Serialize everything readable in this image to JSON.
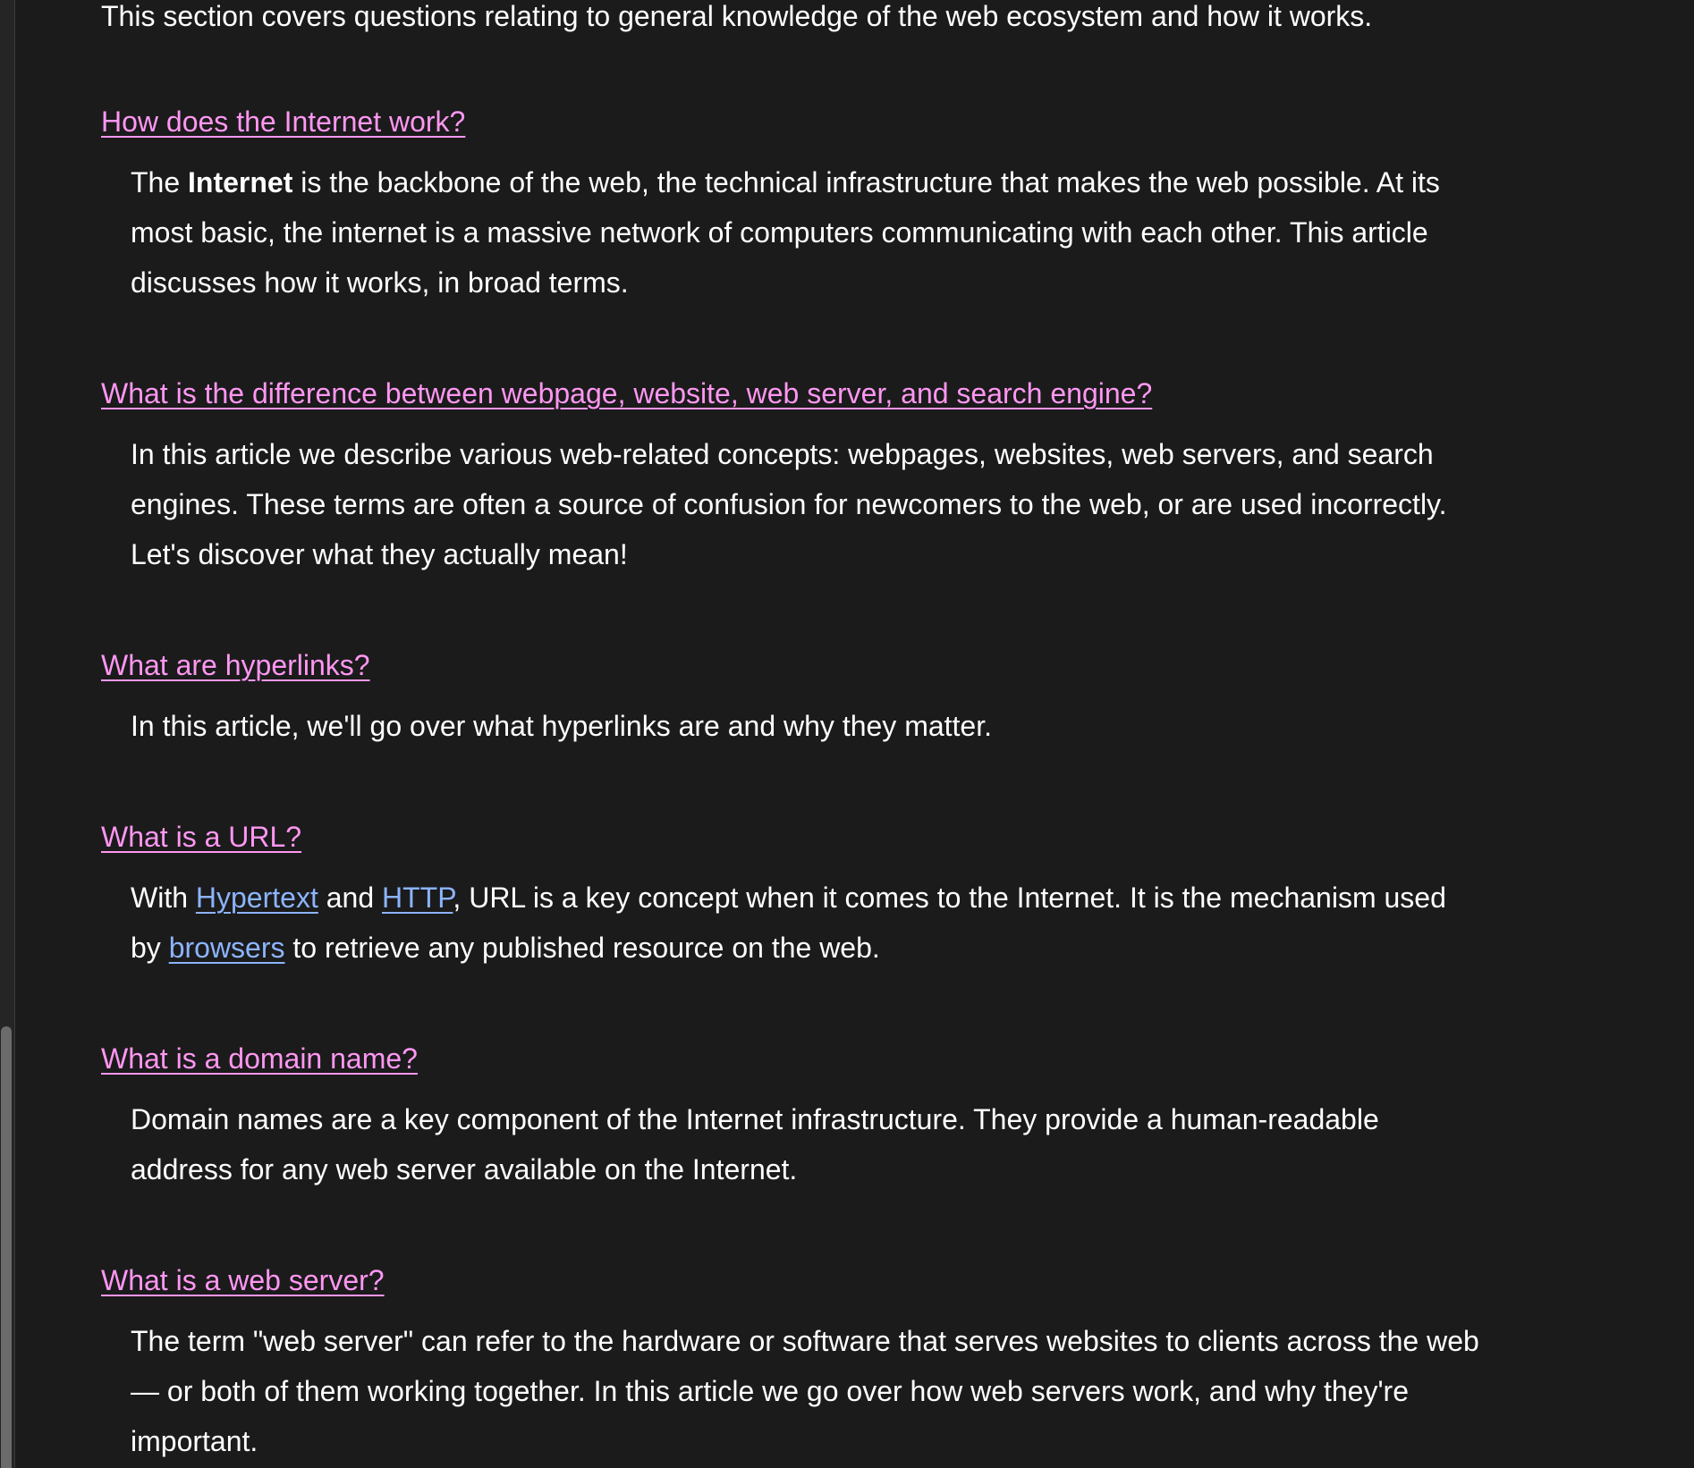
{
  "intro": "This section covers questions relating to general knowledge of the web ecosystem and how it works.",
  "colors": {
    "background": "#1b1b1b",
    "text": "#ffffff",
    "heading_link": "#ff97f2",
    "inline_link": "#8cb4ff"
  },
  "entries": [
    {
      "title": "How does the Internet work?",
      "desc": {
        "pre": "The ",
        "bold": "Internet",
        "post": " is the backbone of the web, the technical infrastructure that makes the web possible. At its most basic, the internet is a massive network of computers communicating with each other. This article discusses how it works, in broad terms."
      }
    },
    {
      "title": "What is the difference between webpage, website, web server, and search engine?",
      "desc": "In this article we describe various web-related concepts: webpages, websites, web servers, and search engines. These terms are often a source of confusion for newcomers to the web, or are used incorrectly. Let's discover what they actually mean!"
    },
    {
      "title": "What are hyperlinks?",
      "desc": "In this article, we'll go over what hyperlinks are and why they matter."
    },
    {
      "title": "What is a URL?",
      "desc": {
        "t1": "With ",
        "link1": "Hypertext",
        "t2": " and ",
        "link2": "HTTP",
        "t3": ", URL is a key concept when it comes to the Internet. It is the mechanism used by ",
        "link3": "browsers",
        "t4": " to retrieve any published resource on the web."
      }
    },
    {
      "title": "What is a domain name?",
      "desc": "Domain names are a key component of the Internet infrastructure. They provide a human-readable address for any web server available on the Internet."
    },
    {
      "title": "What is a web server?",
      "desc": "The term \"web server\" can refer to the hardware or software that serves websites to clients across the web — or both of them working together. In this article we go over how web servers work, and why they're important."
    }
  ]
}
